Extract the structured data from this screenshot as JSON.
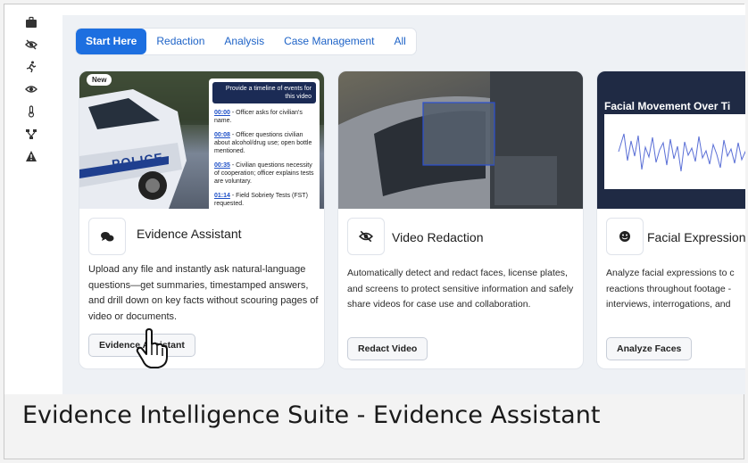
{
  "tabs": [
    {
      "label": "Start Here",
      "active": true
    },
    {
      "label": "Redaction",
      "active": false
    },
    {
      "label": "Analysis",
      "active": false
    },
    {
      "label": "Case Management",
      "active": false
    },
    {
      "label": "All",
      "active": false
    }
  ],
  "sidebar": {
    "icons": [
      "briefcase-icon",
      "eye-off-icon",
      "running-person-icon",
      "eye-icon",
      "thermometer-icon",
      "network-icon",
      "warning-icon"
    ]
  },
  "cards": [
    {
      "badge": "New",
      "title": "Evidence Assistant",
      "icon": "chat-bubbles-icon",
      "description": "Upload any file and instantly ask natural-language questions—get summaries, timestamped answers, and drill down on key facts without scouring pages of video or documents.",
      "button": "Evidence Assistant",
      "thumb": {
        "car_text": "POLICE",
        "prompt": "Provide a timeline of events for this video",
        "timeline": [
          {
            "time": "00:00",
            "text": " - Officer asks for civilian's name."
          },
          {
            "time": "00:08",
            "text": " - Officer questions civilian about alcohol/drug use; open bottle mentioned."
          },
          {
            "time": "00:35",
            "text": " - Civilian questions necessity of cooperation; officer explains tests are voluntary."
          },
          {
            "time": "01:14",
            "text": " - Field Sobriety Tests (FST) requested."
          }
        ]
      }
    },
    {
      "title": "Video Redaction",
      "icon": "eye-off-icon",
      "description": "Automatically detect and redact faces, license plates, and screens to protect sensitive information and safely share videos for case use and collaboration.",
      "button": "Redact Video"
    },
    {
      "title": "Facial Expression",
      "icon": "smiley-icon",
      "description": "Analyze facial expressions to c reactions throughout footage - interviews, interrogations, and",
      "description_lines": [
        "Analyze facial expressions to c",
        "reactions throughout footage -",
        "interviews, interrogations, and"
      ],
      "button": "Analyze Faces",
      "thumb": {
        "chart_title": "Facial Movement Over Ti"
      }
    }
  ],
  "caption": "Evidence Intelligence Suite - Evidence Assistant",
  "colors": {
    "accent": "#1d6fe0",
    "tab_text": "#1e63c7",
    "content_bg": "#eef1f5"
  }
}
